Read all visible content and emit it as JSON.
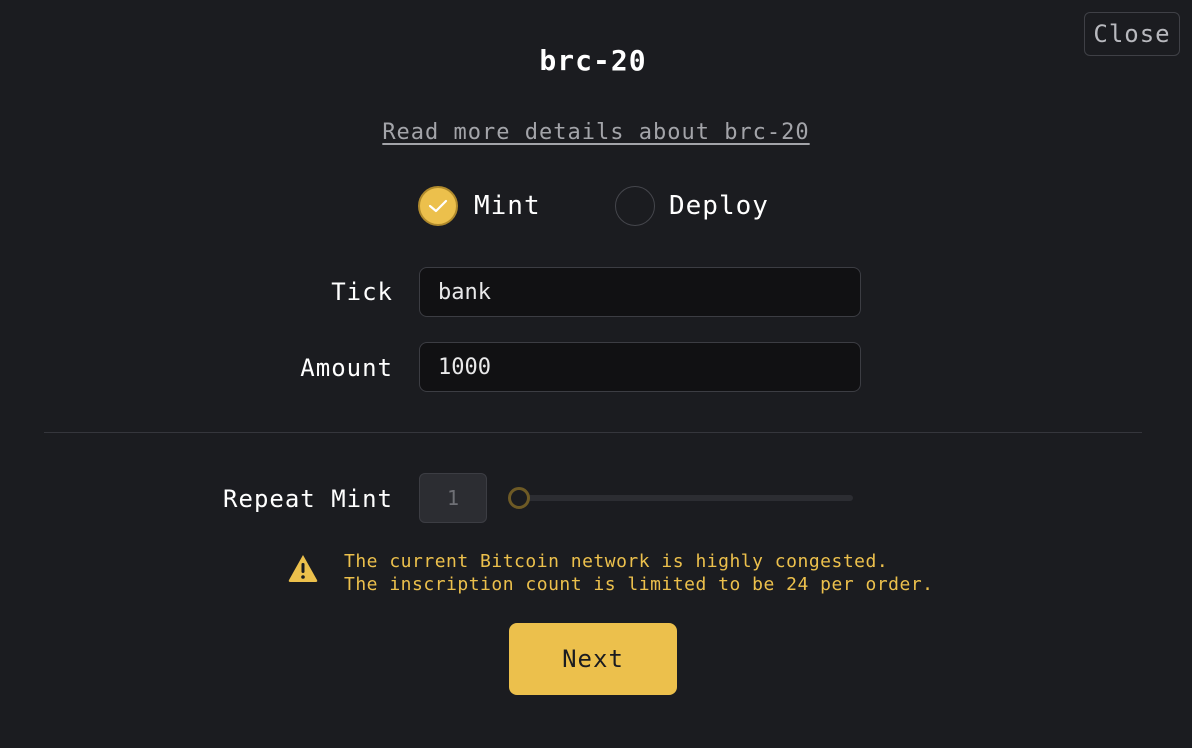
{
  "modal": {
    "title": "brc-20",
    "close_label": "Close",
    "details_link": "Read more details about brc-20"
  },
  "operation": {
    "selected": "Mint",
    "options": [
      {
        "label": "Mint",
        "checked": true
      },
      {
        "label": "Deploy",
        "checked": false
      }
    ]
  },
  "form": {
    "tick_label": "Tick",
    "tick_value": "bank",
    "amount_label": "Amount",
    "amount_value": "1000"
  },
  "repeat": {
    "label": "Repeat Mint",
    "value": "1",
    "slider_level": 0
  },
  "warning": {
    "icon": "warning-triangle-icon",
    "line1": "The current Bitcoin network is highly congested.",
    "line2": "The inscription count is limited to be 24 per order."
  },
  "actions": {
    "next_label": "Next"
  },
  "colors": {
    "background": "#1b1c20",
    "accent": "#ecc04c",
    "input_bg": "#111113"
  }
}
